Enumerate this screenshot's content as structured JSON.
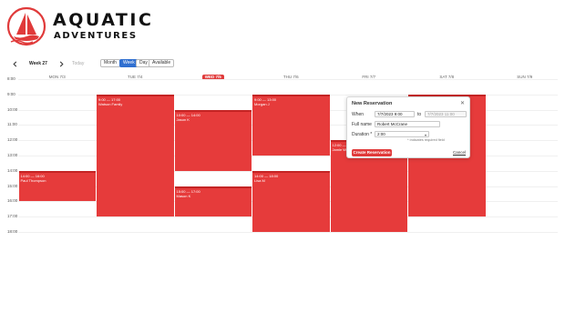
{
  "brand": {
    "name_line1": "AQUATIC",
    "name_line2": "ADVENTURES"
  },
  "colors": {
    "accent": "#e03a3a",
    "event": "#e63b3b",
    "event_top": "#c42424",
    "active_view": "#2f6fd0"
  },
  "toolbar": {
    "prev_icon": "chevron-left-icon",
    "next_icon": "chevron-right-icon",
    "week_label": "Week 27",
    "today_label": "Today",
    "views": [
      {
        "label": "Month",
        "active": false
      },
      {
        "label": "Week",
        "active": true
      },
      {
        "label": "Day",
        "active": false
      },
      {
        "label": "Available",
        "active": false
      }
    ]
  },
  "days": [
    {
      "label": "MON 7/3",
      "today": false
    },
    {
      "label": "TUE 7/4",
      "today": false
    },
    {
      "label": "WED 7/5",
      "today": true
    },
    {
      "label": "THU 7/6",
      "today": false
    },
    {
      "label": "FRI 7/7",
      "today": false
    },
    {
      "label": "SAT 7/8",
      "today": false
    },
    {
      "label": "SUN 7/9",
      "today": false
    }
  ],
  "hours": [
    "8:00",
    "9:00",
    "10:00",
    "11:00",
    "12:00",
    "13:00",
    "14:00",
    "15:00",
    "16:00",
    "17:00",
    "18:00"
  ],
  "events": [
    {
      "day": 0,
      "start": 14,
      "end": 16,
      "time": "14:00 — 16:00",
      "name": "Paul Thompson"
    },
    {
      "day": 1,
      "start": 9,
      "end": 17,
      "time": "9:00 — 17:00",
      "name": "Watson Family"
    },
    {
      "day": 2,
      "start": 10,
      "end": 14,
      "time": "10:00 — 14:00",
      "name": "Jason K"
    },
    {
      "day": 2,
      "start": 15,
      "end": 17,
      "time": "15:00 — 17:00",
      "name": "Mason K"
    },
    {
      "day": 3,
      "start": 9,
      "end": 13,
      "time": "9:00 — 13:00",
      "name": "Morgan J"
    },
    {
      "day": 3,
      "start": 14,
      "end": 18,
      "time": "14:00 — 18:00",
      "name": "Lisa M"
    },
    {
      "day": 4,
      "start": 12,
      "end": 18,
      "time": "12:00 — 18:00",
      "name": "Jamie W"
    },
    {
      "day": 5,
      "start": 9,
      "end": 17,
      "time": "9:00 — 17:00",
      "name": ""
    }
  ],
  "popup": {
    "title": "New Reservation",
    "close_icon": "close-icon",
    "when_label": "When",
    "when_start": "7/7/2023  9:00",
    "to_label": "to",
    "when_end": "7/7/2023  11:00",
    "fullname_label": "Full name",
    "fullname_value": "Robert McCrane",
    "duration_label": "Duration *",
    "duration_value": "2:00",
    "required_note": "* Indicates required field",
    "create_label": "Create Reservation",
    "cancel_label": "Cancel"
  }
}
